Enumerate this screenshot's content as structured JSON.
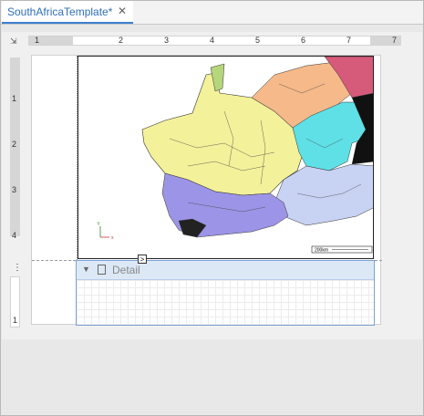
{
  "document_tab": {
    "title": "SouthAfricaTemplate*",
    "close_glyph": "✕"
  },
  "ruler": {
    "horizontal_numbers": [
      "1",
      "2",
      "3",
      "4",
      "5",
      "6",
      "7"
    ],
    "vertical_numbers": [
      "1",
      "2",
      "3",
      "4"
    ],
    "vertical_numbers_detail": [
      "1"
    ]
  },
  "map": {
    "scale_label": "200km"
  },
  "detail_band": {
    "label": "Detail",
    "expand_glyph": "▼",
    "smart_tag_glyph": ">"
  },
  "colors": {
    "accent": "#3c7fd1",
    "band_header": "#dde8f6"
  }
}
